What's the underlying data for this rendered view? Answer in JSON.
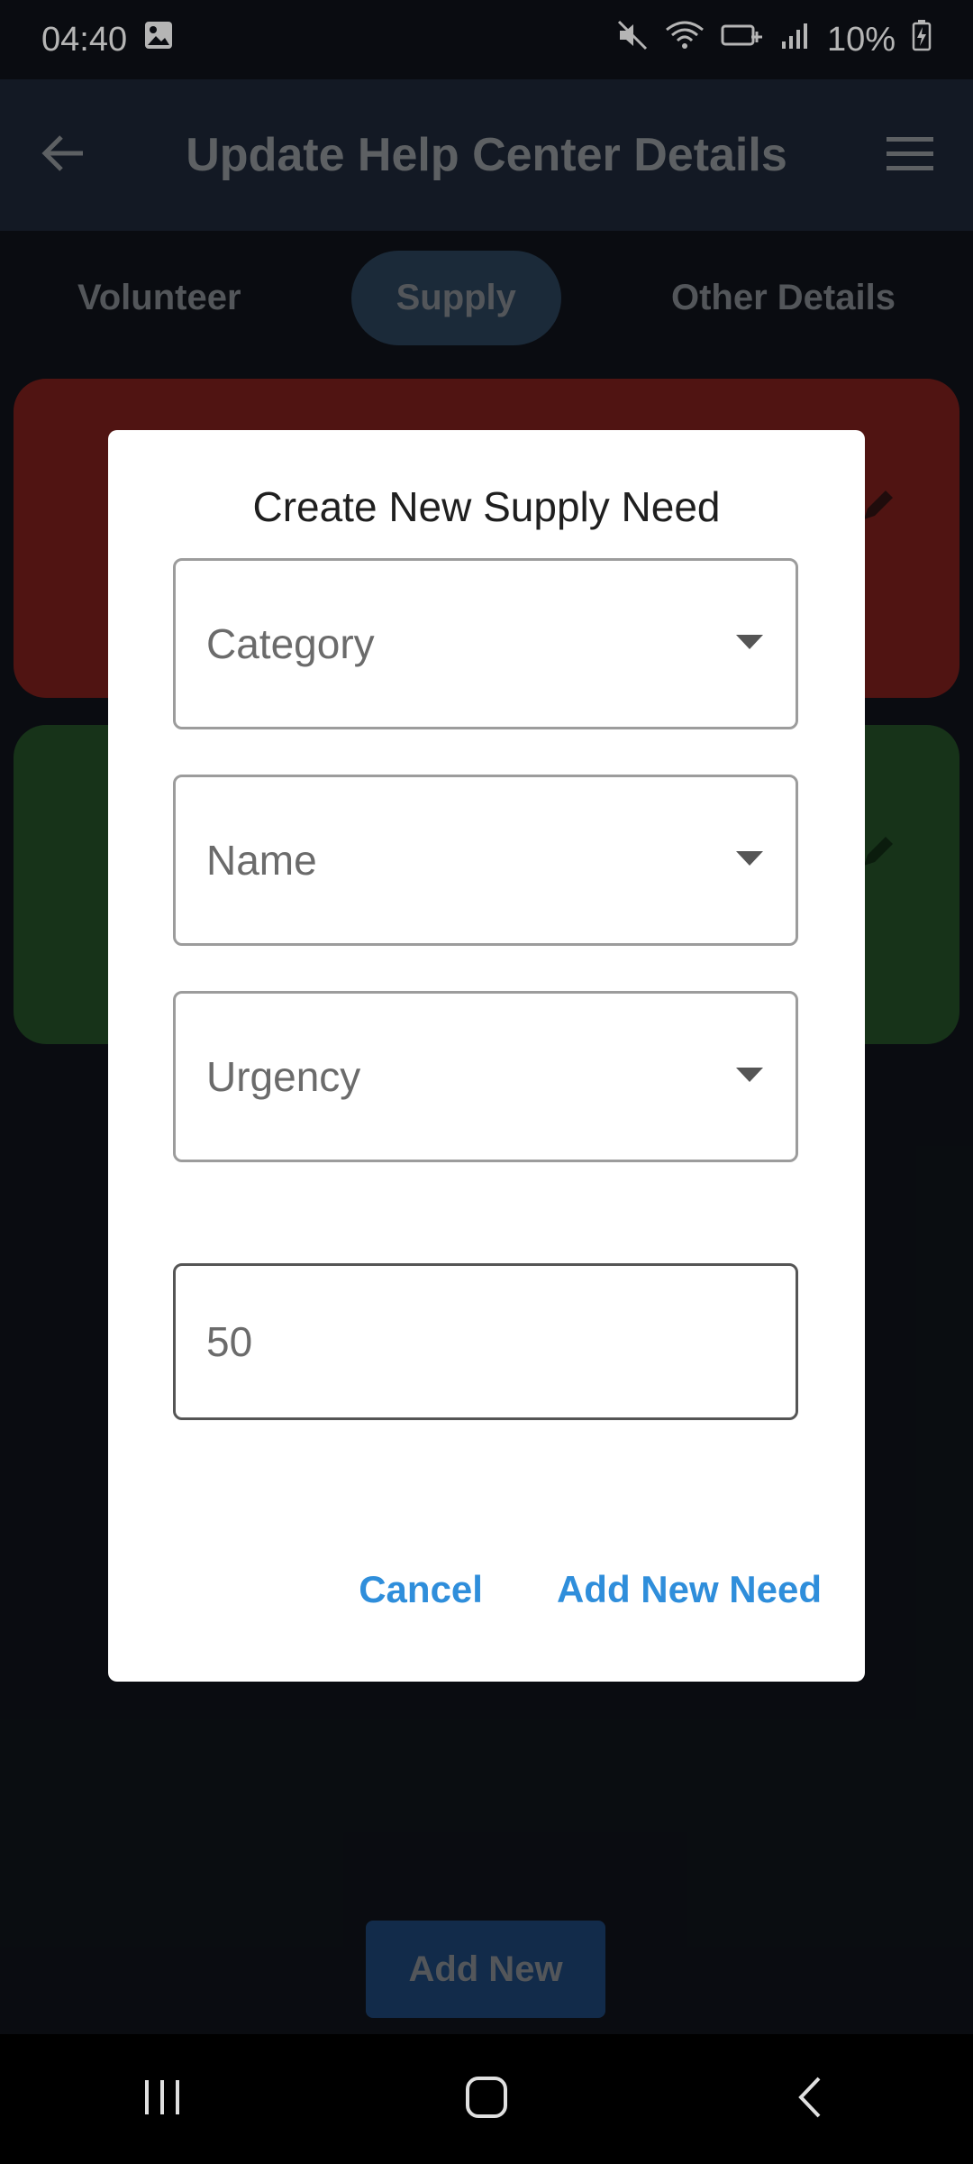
{
  "status": {
    "time": "04:40",
    "battery": "10%"
  },
  "app_bar": {
    "title": "Update Help Center Details"
  },
  "tabs": [
    {
      "label": "Volunteer"
    },
    {
      "label": "Supply"
    },
    {
      "label": "Other Details"
    }
  ],
  "dialog": {
    "title": "Create New Supply Need",
    "fields": [
      {
        "label": "Category"
      },
      {
        "label": "Name"
      },
      {
        "label": "Urgency"
      }
    ],
    "quantity_value": "50",
    "cancel_label": "Cancel",
    "confirm_label": "Add New Need"
  },
  "add_new_label": "Add New",
  "colors": {
    "accent": "#2f8edb",
    "red_card": "#6b1b18",
    "green_card": "#1f4422"
  }
}
